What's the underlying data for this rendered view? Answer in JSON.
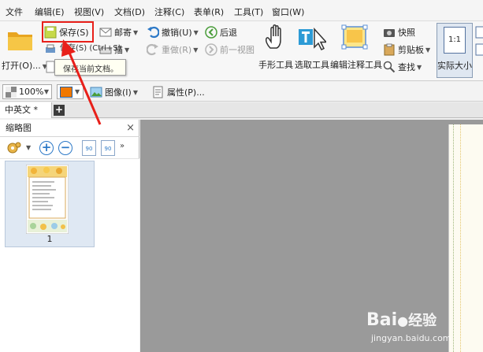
{
  "menu": [
    "文件",
    "编辑(E)",
    "视图(V)",
    "文档(D)",
    "注释(C)",
    "表单(R)",
    "工具(T)",
    "窗口(W)"
  ],
  "ribbon": {
    "open_label": "打开(O)...",
    "save_label": "保存(S)",
    "mail_label": "邮寄",
    "scan_label": "描",
    "undo_label": "撤销(U)",
    "redo_label": "重做(R)",
    "back_label": "后退",
    "forward_label": "前一视图",
    "hand_label": "手形工具",
    "select_label": "选取工具",
    "edit_annot_label": "编辑注释工具",
    "snapshot_label": "快照",
    "clipboard_label": "剪贴板",
    "find_label": "查找",
    "actual_size_label": "实际大小",
    "actual_size_icon": "1:1"
  },
  "tooltip": {
    "title": "保存(S) (Ctrl+S)",
    "description": "保存当前文档。"
  },
  "toolbar2": {
    "zoom": "100%",
    "image_label": "图像(I)",
    "properties_label": "属性(P)..."
  },
  "tabs": [
    {
      "label": "中英文 *"
    }
  ],
  "tab_add": "+",
  "panel": {
    "title": "缩略图",
    "close": "×",
    "rotate_left": "90",
    "rotate_right": "90",
    "page_number": "1"
  },
  "watermark": {
    "brand": "Bai",
    "brand_suffix": "经验",
    "url": "jingyan.baidu.com"
  },
  "colors": {
    "highlight_red": "#e8201a",
    "accent_blue": "#2d79c7",
    "doc_background": "#9a9a9a"
  }
}
